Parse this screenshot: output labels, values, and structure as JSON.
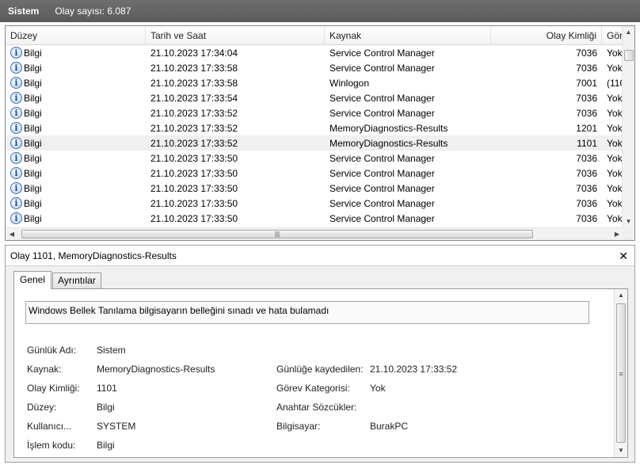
{
  "titlebar": {
    "log_name": "Sistem",
    "event_count": "Olay sayısı: 6.087"
  },
  "columns": {
    "level": "Düzey",
    "date": "Tarih ve Saat",
    "source": "Kaynak",
    "event_id": "Olay Kimliği",
    "task": "Gör"
  },
  "icons": {
    "info": "info-icon",
    "close": "close-icon"
  },
  "events": [
    {
      "level": "Bilgi",
      "date": "21.10.2023 17:34:04",
      "source": "Service Control Manager",
      "id": "7036",
      "task": "Yok"
    },
    {
      "level": "Bilgi",
      "date": "21.10.2023 17:33:58",
      "source": "Service Control Manager",
      "id": "7036",
      "task": "Yok"
    },
    {
      "level": "Bilgi",
      "date": "21.10.2023 17:33:58",
      "source": "Winlogon",
      "id": "7001",
      "task": "(110"
    },
    {
      "level": "Bilgi",
      "date": "21.10.2023 17:33:54",
      "source": "Service Control Manager",
      "id": "7036",
      "task": "Yok"
    },
    {
      "level": "Bilgi",
      "date": "21.10.2023 17:33:52",
      "source": "Service Control Manager",
      "id": "7036",
      "task": "Yok"
    },
    {
      "level": "Bilgi",
      "date": "21.10.2023 17:33:52",
      "source": "MemoryDiagnostics-Results",
      "id": "1201",
      "task": "Yok"
    },
    {
      "level": "Bilgi",
      "date": "21.10.2023 17:33:52",
      "source": "MemoryDiagnostics-Results",
      "id": "1101",
      "task": "Yok",
      "selected": true
    },
    {
      "level": "Bilgi",
      "date": "21.10.2023 17:33:50",
      "source": "Service Control Manager",
      "id": "7036",
      "task": "Yok"
    },
    {
      "level": "Bilgi",
      "date": "21.10.2023 17:33:50",
      "source": "Service Control Manager",
      "id": "7036",
      "task": "Yok"
    },
    {
      "level": "Bilgi",
      "date": "21.10.2023 17:33:50",
      "source": "Service Control Manager",
      "id": "7036",
      "task": "Yok"
    },
    {
      "level": "Bilgi",
      "date": "21.10.2023 17:33:50",
      "source": "Service Control Manager",
      "id": "7036",
      "task": "Yok"
    },
    {
      "level": "Bilgi",
      "date": "21.10.2023 17:33:50",
      "source": "Service Control Manager",
      "id": "7036",
      "task": "Yok"
    }
  ],
  "detail": {
    "title": "Olay 1101, MemoryDiagnostics-Results",
    "tabs": [
      "Genel",
      "Ayrıntılar"
    ],
    "description": "Windows Bellek Tanılama bilgisayarın belleğini sınadı ve hata bulamadı",
    "labels": {
      "log_name": "Günlük Adı:",
      "source": "Kaynak:",
      "event_id": "Olay Kimliği:",
      "level": "Düzey:",
      "user": "Kullanıcı...",
      "opcode": "İşlem kodu:",
      "logged": "Günlüğe kaydedilen:",
      "task_category": "Görev Kategorisi:",
      "keywords": "Anahtar Sözcükler:",
      "computer": "Bilgisayar:"
    },
    "values": {
      "log_name": "Sistem",
      "source": "MemoryDiagnostics-Results",
      "event_id": "1101",
      "level": "Bilgi",
      "user": "SYSTEM",
      "opcode": "Bilgi",
      "logged": "21.10.2023 17:33:52",
      "task_category": "Yok",
      "keywords": "",
      "computer": "BurakPC"
    }
  }
}
